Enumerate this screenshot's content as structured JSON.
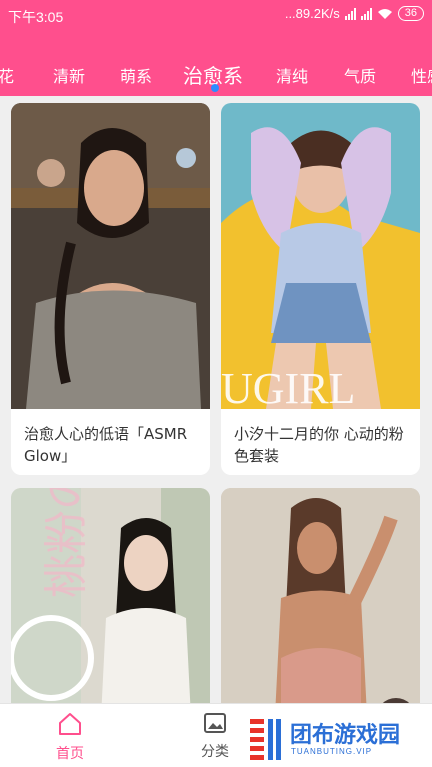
{
  "status_bar": {
    "time": "下午3:05",
    "speed": "...89.2K/s",
    "battery": "36"
  },
  "tabs": [
    {
      "label": "花"
    },
    {
      "label": "清新"
    },
    {
      "label": "萌系"
    },
    {
      "label": "治愈系",
      "active": true
    },
    {
      "label": "清纯"
    },
    {
      "label": "气质"
    },
    {
      "label": "性感"
    }
  ],
  "cards": [
    {
      "title": "治愈人心的低语「ASMR Glow」",
      "image": "photo-woman-grey-knit-top"
    },
    {
      "title": "小汐十二月的你 心动的粉色套装",
      "image": "photo-woman-pastel-sweater-yellow-chair",
      "image_text": "UGIRL"
    },
    {
      "title": "",
      "image": "photo-girl-school-uniform",
      "image_text": "桃粉の"
    },
    {
      "title": "",
      "image": "photo-woman-wet-hair-bathroom"
    }
  ],
  "bottom_nav": {
    "home": "首页",
    "category": "分类"
  },
  "watermark": {
    "name": "团布游戏园",
    "url": "TUANBUTING.VIP"
  },
  "colors": {
    "brand_pink": "#ff4f8d",
    "indicator_blue": "#2d8cff",
    "watermark_blue": "#2b6fd6"
  }
}
